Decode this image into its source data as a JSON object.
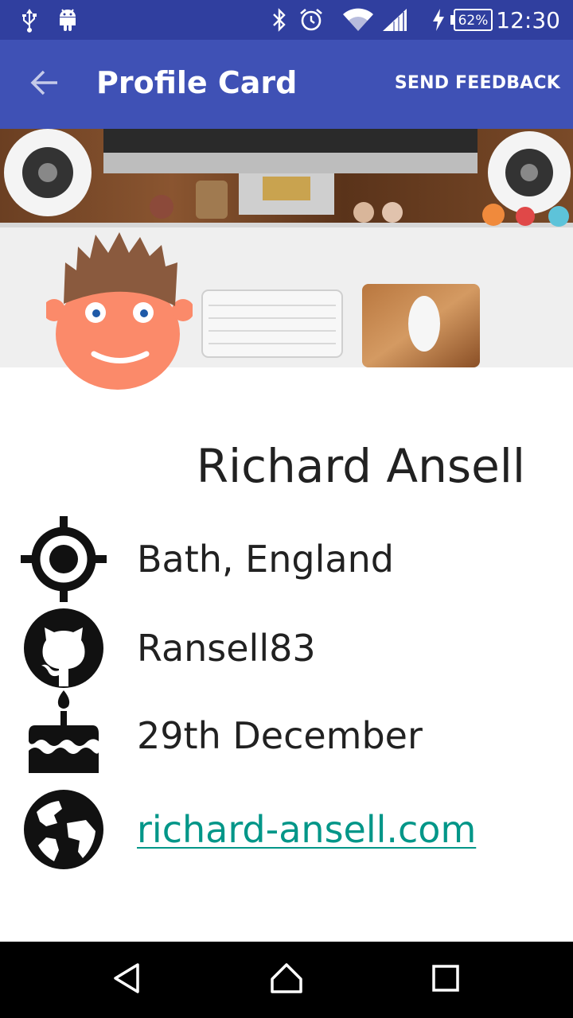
{
  "status_bar": {
    "time": "12:30",
    "battery_percent": "62%",
    "icons": [
      "usb-icon",
      "android-icon",
      "bluetooth-icon",
      "alarm-icon",
      "wifi-icon",
      "signal-icon",
      "charging-icon",
      "battery-icon"
    ],
    "color": "#303f9f"
  },
  "app_bar": {
    "title": "Profile Card",
    "action_label": "SEND FEEDBACK",
    "back_icon": "arrow-back-icon",
    "color": "#3f51b5"
  },
  "profile": {
    "name": "Richard Ansell",
    "items": [
      {
        "icon": "location-icon",
        "text": "Bath, England"
      },
      {
        "icon": "github-icon",
        "text": "Ransell83"
      },
      {
        "icon": "cake-icon",
        "text": "29th December"
      },
      {
        "icon": "globe-icon",
        "text": "richard-ansell.com",
        "link_color": "#009688"
      }
    ]
  },
  "nav_bar": {
    "buttons": [
      "back-triangle-icon",
      "home-icon",
      "recents-icon"
    ]
  }
}
